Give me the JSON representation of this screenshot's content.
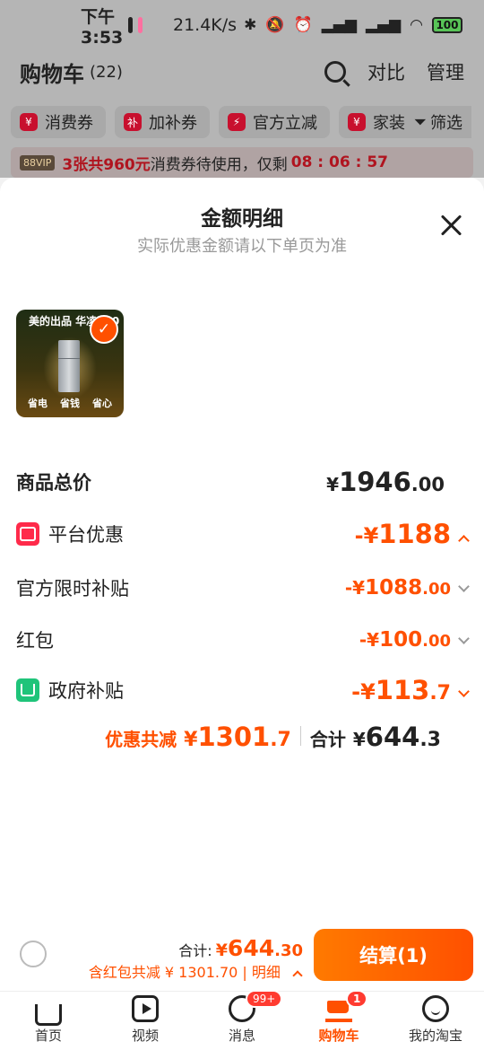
{
  "status_bar": {
    "time": "下午3:53",
    "speed": "21.4K/s",
    "battery": "100"
  },
  "header": {
    "title": "购物车",
    "count": "(22)",
    "compare": "对比",
    "manage": "管理"
  },
  "chips": [
    {
      "icon": "¥",
      "label": "消费券"
    },
    {
      "icon": "补",
      "label": "加补券"
    },
    {
      "icon": "⚡",
      "label": "官方立减"
    },
    {
      "icon": "¥",
      "label": "家装"
    }
  ],
  "filter_label": "筛选",
  "vip_banner": {
    "badge": "88VIP",
    "highlight": "3张共960元",
    "text": "消费券待使用，仅剩",
    "countdown": "08 : 06 : 57"
  },
  "sheet": {
    "title": "金额明细",
    "subtitle": "实际优惠金额请以下单页为准"
  },
  "product_thumb": {
    "headline": "美的出品 华凌190",
    "labels": [
      "省电",
      "省钱",
      "省心"
    ]
  },
  "rows": {
    "total": {
      "label": "商品总价",
      "symbol": "¥",
      "int": "1946",
      "dec": ".00"
    },
    "platform": {
      "label": "平台优惠",
      "symbol": "-¥",
      "int": "1188",
      "dec": ""
    },
    "official": {
      "label": "官方限时补贴",
      "symbol": "-¥",
      "int": "1088",
      "dec": ".00"
    },
    "hongbao": {
      "label": "红包",
      "symbol": "-¥",
      "int": "100",
      "dec": ".00"
    },
    "gov": {
      "label": "政府补贴",
      "symbol": "-¥",
      "int": "113",
      "dec": ".7"
    }
  },
  "summary": {
    "discount_label": "优惠共减",
    "discount_symbol": "¥",
    "discount_int": "1301",
    "discount_dec": ".7",
    "total_label": "合计",
    "total_symbol": "¥",
    "total_int": "644",
    "total_dec": ".3"
  },
  "checkout": {
    "total_label": "合计:",
    "total_symbol": "¥",
    "total_int": "644",
    "total_dec": ".30",
    "discount_text": "含红包共减 ¥ 1301.70 | 明细",
    "button": "结算(1)"
  },
  "tabs": [
    {
      "label": "首页"
    },
    {
      "label": "视频"
    },
    {
      "label": "消息",
      "badge": "99+"
    },
    {
      "label": "购物车",
      "badge": "1"
    },
    {
      "label": "我的淘宝"
    }
  ]
}
